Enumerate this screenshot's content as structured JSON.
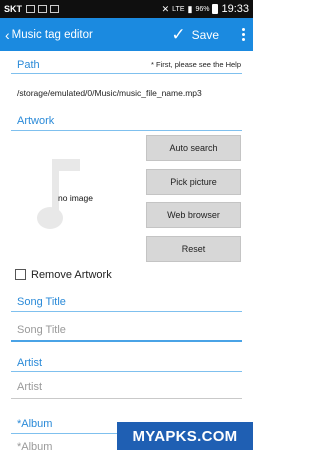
{
  "status_bar": {
    "carrier": "SKT",
    "network": "LTE",
    "battery": "96%",
    "time": "19:33"
  },
  "action_bar": {
    "title": "Music tag editor",
    "save_label": "Save"
  },
  "path_section": {
    "label": "Path",
    "hint": "* First, please see the Help",
    "value": "/storage/emulated/0/Music/music_file_name.mp3"
  },
  "artwork_section": {
    "label": "Artwork",
    "placeholder_text": "no image",
    "buttons": [
      "Auto search",
      "Pick picture",
      "Web browser",
      "Reset"
    ],
    "remove_label": "Remove Artwork",
    "remove_checked": false
  },
  "song_title": {
    "label": "Song Title",
    "placeholder": "Song Title"
  },
  "artist": {
    "label": "Artist",
    "placeholder": "Artist"
  },
  "album": {
    "label": "*Album",
    "placeholder": "*Album"
  },
  "watermark": "MYAPKS.COM",
  "colors": {
    "accent": "#1b8ae0",
    "section_label": "#2a8ad8"
  }
}
